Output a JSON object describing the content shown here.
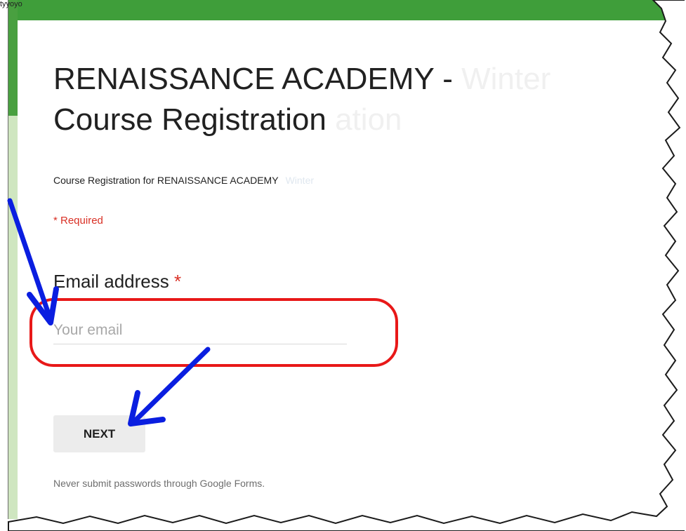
{
  "caption": "tyyoyo",
  "form": {
    "title_line1": "RENAISSANCE ACADEMY -",
    "title_line1_fade": "Winter",
    "title_line2": "Course Registration",
    "title_line2_fade": "ation",
    "description": "Course Registration for RENAISSANCE ACADEMY",
    "description_fade": "Winter",
    "required_note": "* Required",
    "question_label": "Email address",
    "required_star": "*",
    "email_placeholder": "Your email",
    "email_value": "",
    "next_label": "NEXT",
    "footer_note": "Never submit passwords through Google Forms."
  },
  "colors": {
    "brand_green": "#3f9e3a",
    "required_red": "#d93025",
    "highlight_red": "#e81818",
    "annotation_blue": "#0a1ee0"
  }
}
